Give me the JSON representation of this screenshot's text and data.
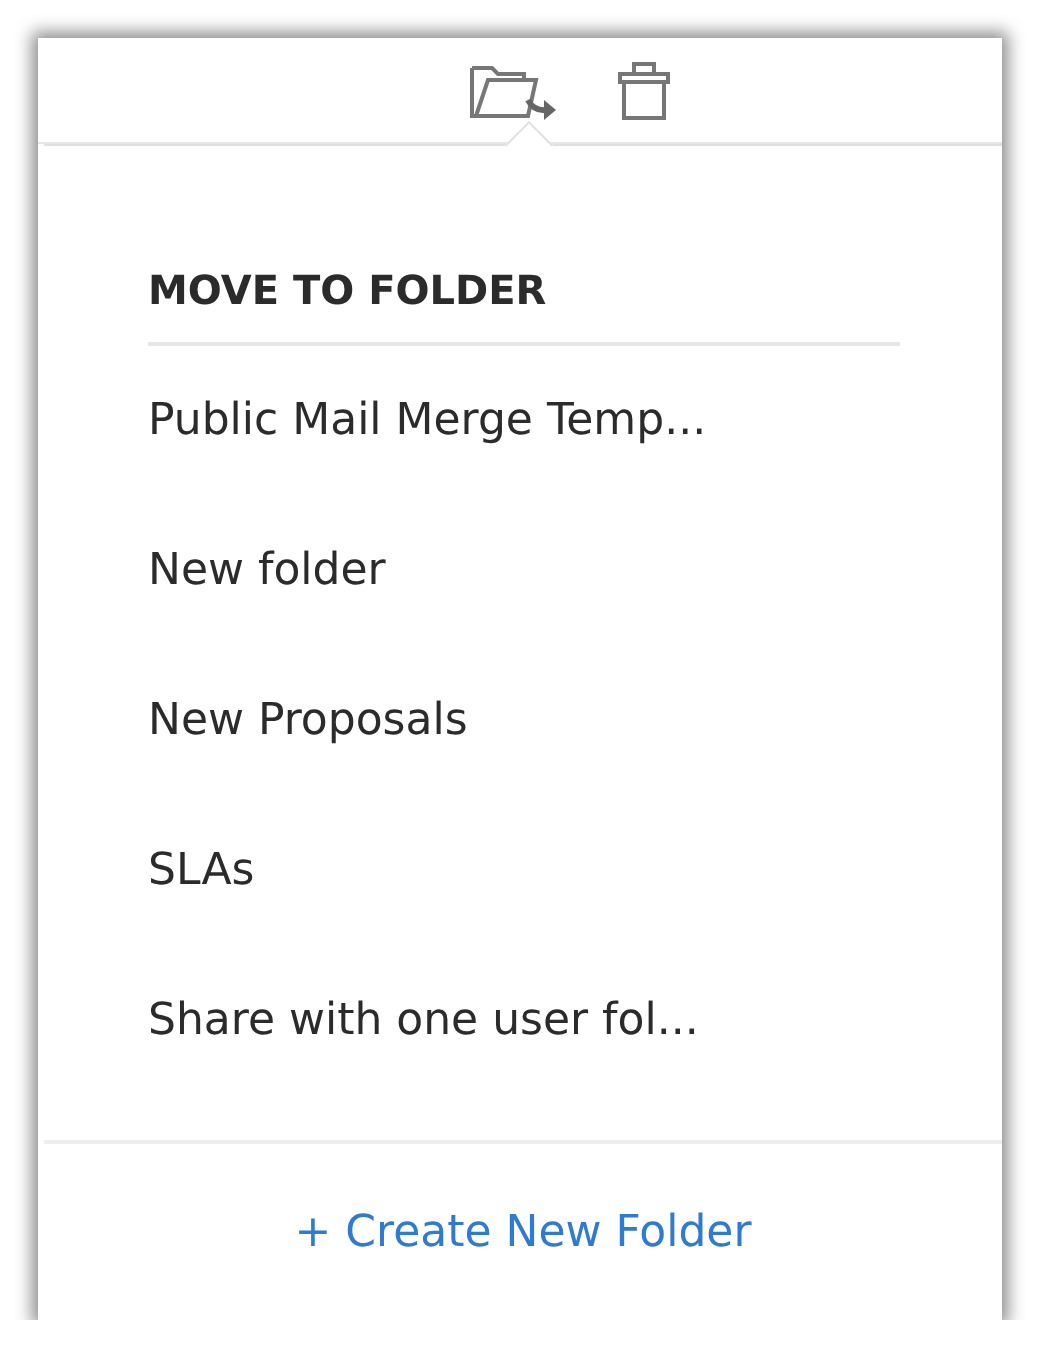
{
  "popover": {
    "title": "MOVE TO FOLDER",
    "folders": [
      {
        "name": "Public Mail Merge Temp..."
      },
      {
        "name": "New folder"
      },
      {
        "name": "New Proposals"
      },
      {
        "name": "SLAs"
      },
      {
        "name": "Share with one user fol..."
      }
    ],
    "footer_link": "+ Create New Folder"
  }
}
